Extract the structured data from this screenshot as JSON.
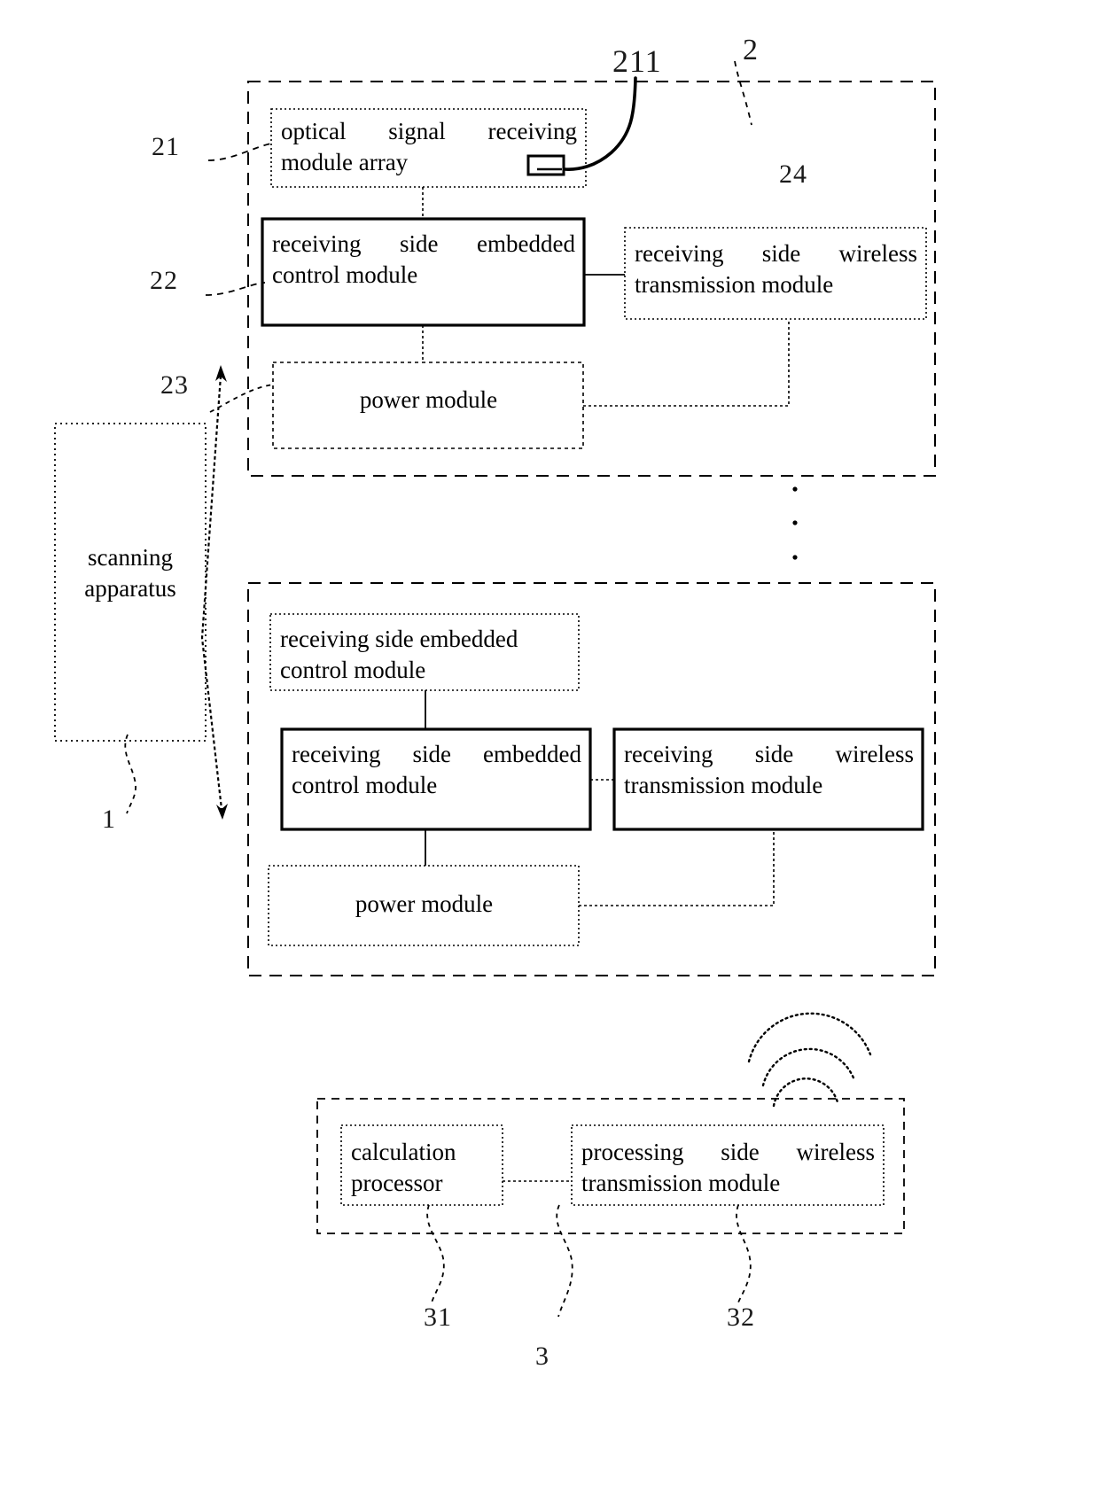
{
  "figure": {
    "type": "patent-block-diagram",
    "background_color": "#ffffff",
    "line_color": "#000000"
  },
  "blocks": {
    "scanning_apparatus": "scanning apparatus",
    "optical_signal_receiving_module_array": "optical signal receiving module array",
    "receiving_side_embedded_control_module_top": "receiving side embedded control module",
    "receiving_side_wireless_transmission_module_top": "receiving side wireless transmission module",
    "power_module_top": "power module",
    "receiving_side_embedded_control_module_mid_upper": "receiving side embedded control module",
    "receiving_side_embedded_control_module_mid": "receiving side embedded control module",
    "receiving_side_wireless_transmission_module_mid": "receiving side wireless transmission module",
    "power_module_mid": "power module",
    "calculation_processor": "calculation processor",
    "processing_side_wireless_transmission_module": "processing side wireless transmission module"
  },
  "reference_numerals": {
    "n211": "211",
    "n2": "2",
    "n21": "21",
    "n22": "22",
    "n23": "23",
    "n24": "24",
    "n1": "1",
    "n31": "31",
    "n3": "3",
    "n32": "32"
  }
}
